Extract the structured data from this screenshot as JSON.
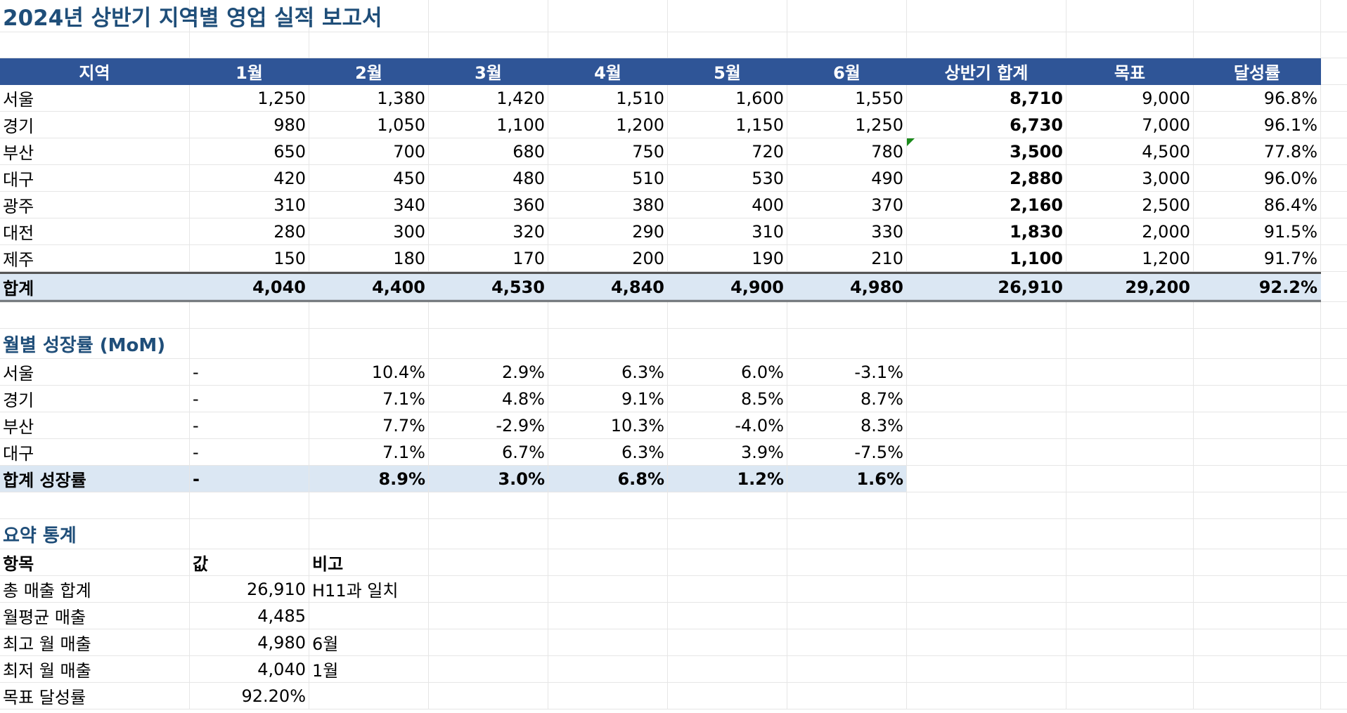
{
  "title": "2024년 상반기 지역별 영업 실적 보고서",
  "sales_table": {
    "headers": [
      "지역",
      "1월",
      "2월",
      "3월",
      "4월",
      "5월",
      "6월",
      "상반기 합계",
      "목표",
      "달성률"
    ],
    "rows": [
      [
        "서울",
        "1,250",
        "1,380",
        "1,420",
        "1,510",
        "1,600",
        "1,550",
        "8,710",
        "9,000",
        "96.8%"
      ],
      [
        "경기",
        "980",
        "1,050",
        "1,100",
        "1,200",
        "1,150",
        "1,250",
        "6,730",
        "7,000",
        "96.1%"
      ],
      [
        "부산",
        "650",
        "700",
        "680",
        "750",
        "720",
        "780",
        "3,500",
        "4,500",
        "77.8%"
      ],
      [
        "대구",
        "420",
        "450",
        "480",
        "510",
        "530",
        "490",
        "2,880",
        "3,000",
        "96.0%"
      ],
      [
        "광주",
        "310",
        "340",
        "360",
        "380",
        "400",
        "370",
        "2,160",
        "2,500",
        "86.4%"
      ],
      [
        "대전",
        "280",
        "300",
        "320",
        "290",
        "310",
        "330",
        "1,830",
        "2,000",
        "91.5%"
      ],
      [
        "제주",
        "150",
        "180",
        "170",
        "200",
        "190",
        "210",
        "1,100",
        "1,200",
        "91.7%"
      ]
    ],
    "total": [
      "합계",
      "4,040",
      "4,400",
      "4,530",
      "4,840",
      "4,900",
      "4,980",
      "26,910",
      "29,200",
      "92.2%"
    ]
  },
  "growth": {
    "title": "월별 성장률 (MoM)",
    "rows": [
      [
        "서울",
        "-",
        "10.4%",
        "2.9%",
        "6.3%",
        "6.0%",
        "-3.1%"
      ],
      [
        "경기",
        "-",
        "7.1%",
        "4.8%",
        "9.1%",
        "8.5%",
        "8.7%"
      ],
      [
        "부산",
        "-",
        "7.7%",
        "-2.9%",
        "10.3%",
        "-4.0%",
        "8.3%"
      ],
      [
        "대구",
        "-",
        "7.1%",
        "6.7%",
        "6.3%",
        "3.9%",
        "-7.5%"
      ]
    ],
    "total": [
      "합계 성장률",
      "-",
      "8.9%",
      "3.0%",
      "6.8%",
      "1.2%",
      "1.6%"
    ]
  },
  "summary": {
    "title": "요약 통계",
    "headers": [
      "항목",
      "값",
      "비고"
    ],
    "rows": [
      [
        "총 매출 합계",
        "26,910",
        "H11과 일치"
      ],
      [
        "월평균 매출",
        "4,485",
        ""
      ],
      [
        "최고 월 매출",
        "4,980",
        "6월"
      ],
      [
        "최저 월 매출",
        "4,040",
        "1월"
      ],
      [
        "목표 달성률",
        "92.20%",
        ""
      ]
    ]
  },
  "colors": {
    "header_bg": "#2f5597",
    "header_text": "#ffffff",
    "total_bg": "#dbe7f3",
    "title_text": "#1f4e79",
    "comment_indicator": "#1a8a1a"
  }
}
